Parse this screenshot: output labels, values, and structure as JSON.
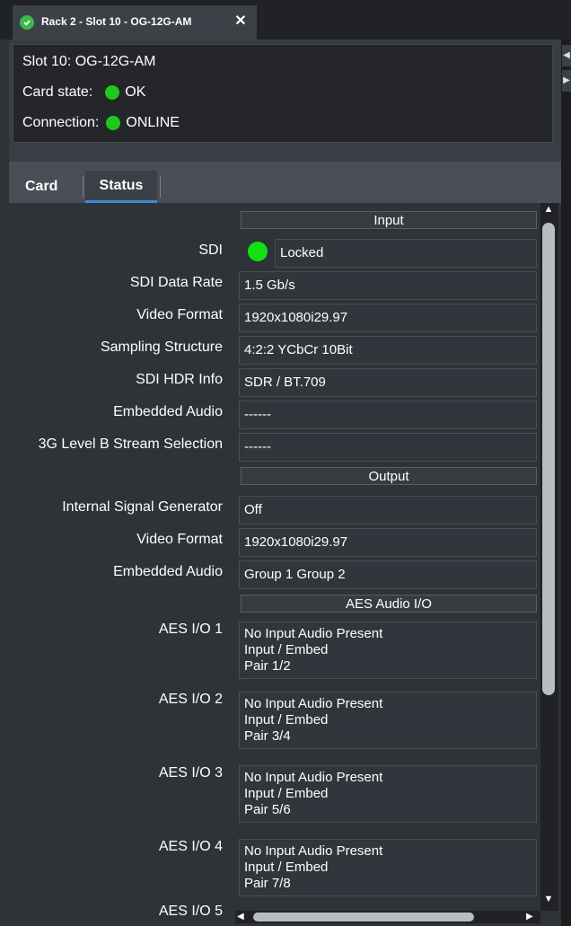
{
  "tab": {
    "title": "Rack 2 - Slot 10 - OG-12G-AM",
    "close": "✕"
  },
  "info": {
    "slot": "Slot 10: OG-12G-AM",
    "card_state_label": "Card state:",
    "card_state_value": "OK",
    "connection_label": "Connection:",
    "connection_value": "ONLINE",
    "status_color": "#1ec91e"
  },
  "subtabs": {
    "card": "Card",
    "status": "Status"
  },
  "sections": {
    "input": "Input",
    "output": "Output",
    "aes": "AES Audio I/O"
  },
  "input": {
    "sdi_label": "SDI",
    "sdi_value": "Locked",
    "rate_label": "SDI Data Rate",
    "rate_value": "1.5 Gb/s",
    "format_label": "Video Format",
    "format_value": "1920x1080i29.97",
    "sampling_label": "Sampling Structure",
    "sampling_value": "4:2:2 YCbCr 10Bit",
    "hdr_label": "SDI HDR Info",
    "hdr_value": "SDR / BT.709",
    "audio_label": "Embedded Audio",
    "audio_value": "------",
    "level_b_label": "3G Level B Stream Selection",
    "level_b_value": "------"
  },
  "output": {
    "gen_label": "Internal Signal Generator",
    "gen_value": "Off",
    "format_label": "Video Format",
    "format_value": "1920x1080i29.97",
    "audio_label": "Embedded Audio",
    "audio_value": "Group 1 Group 2"
  },
  "aes": [
    {
      "label": "AES I/O 1",
      "l1": "No Input Audio Present",
      "l2": "Input / Embed",
      "l3": "Pair 1/2"
    },
    {
      "label": "AES I/O 2",
      "l1": "No Input Audio Present",
      "l2": "Input / Embed",
      "l3": "Pair 3/4"
    },
    {
      "label": "AES I/O 3",
      "l1": "No Input Audio Present",
      "l2": "Input / Embed",
      "l3": "Pair 5/6"
    },
    {
      "label": "AES I/O 4",
      "l1": "No Input Audio Present",
      "l2": "Input / Embed",
      "l3": "Pair 7/8"
    },
    {
      "label": "AES I/O 5"
    }
  ],
  "colors": {
    "accent": "#3b8ad8",
    "ok_green": "#1ec91e",
    "locked_green": "#13e013"
  }
}
